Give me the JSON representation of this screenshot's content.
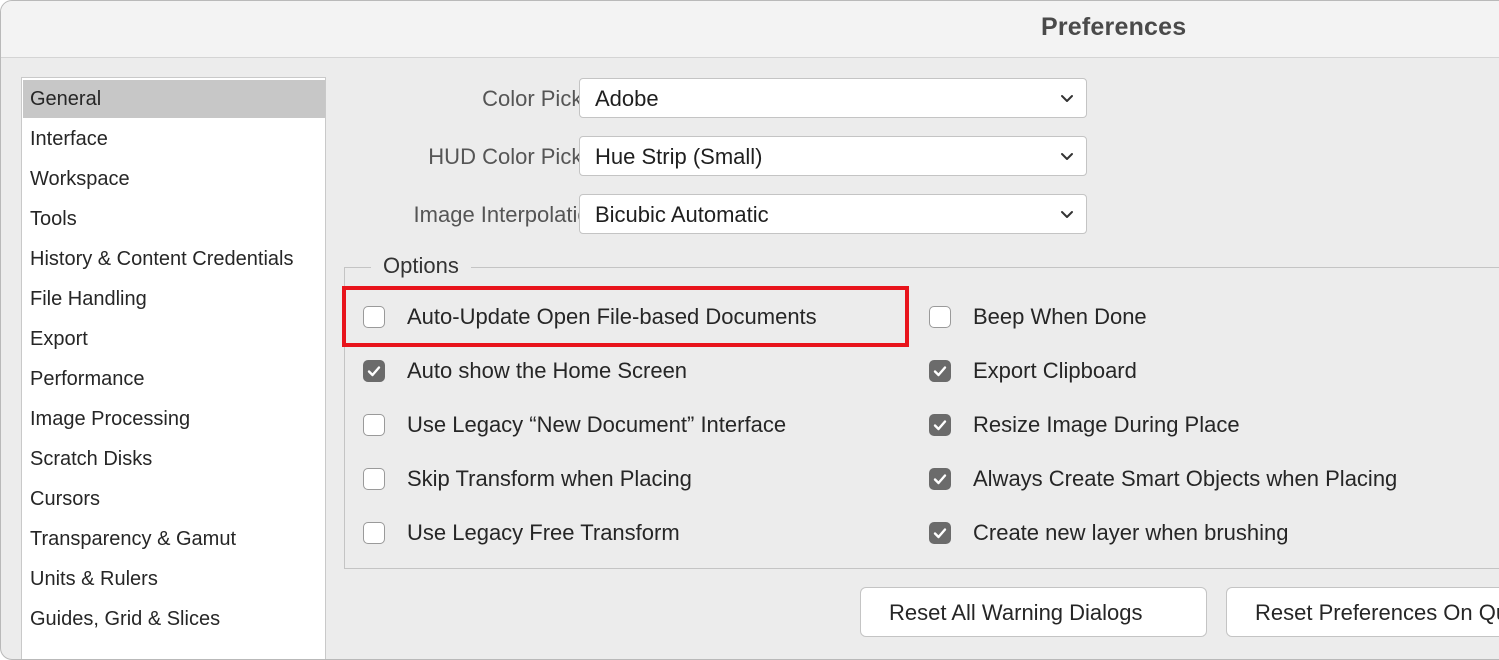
{
  "window": {
    "title": "Preferences"
  },
  "sidebar": {
    "items": [
      {
        "label": "General",
        "selected": true
      },
      {
        "label": "Interface"
      },
      {
        "label": "Workspace"
      },
      {
        "label": "Tools"
      },
      {
        "label": "History & Content Credentials"
      },
      {
        "label": "File Handling"
      },
      {
        "label": "Export"
      },
      {
        "label": "Performance"
      },
      {
        "label": "Image Processing"
      },
      {
        "label": "Scratch Disks"
      },
      {
        "label": "Cursors"
      },
      {
        "label": "Transparency & Gamut"
      },
      {
        "label": "Units & Rulers"
      },
      {
        "label": "Guides, Grid & Slices"
      }
    ]
  },
  "general": {
    "color_picker": {
      "label": "Color Picker:",
      "value": "Adobe"
    },
    "hud_color_picker": {
      "label": "HUD Color Picker:",
      "value": "Hue Strip (Small)"
    },
    "image_interpolation": {
      "label": "Image Interpolation:",
      "value": "Bicubic Automatic"
    },
    "options": {
      "legend": "Options",
      "left": [
        {
          "label": "Auto-Update Open File-based Documents",
          "checked": false,
          "highlighted": true
        },
        {
          "label": "Auto show the Home Screen",
          "checked": true
        },
        {
          "label": "Use Legacy “New Document” Interface",
          "checked": false
        },
        {
          "label": "Skip Transform when Placing",
          "checked": false
        },
        {
          "label": "Use Legacy Free Transform",
          "checked": false
        }
      ],
      "right": [
        {
          "label": "Beep When Done",
          "checked": false
        },
        {
          "label": "Export Clipboard",
          "checked": true
        },
        {
          "label": "Resize Image During Place",
          "checked": true
        },
        {
          "label": "Always Create Smart Objects when Placing",
          "checked": true
        },
        {
          "label": "Create new layer when brushing",
          "checked": true
        }
      ]
    },
    "buttons": {
      "reset_warning": "Reset All Warning Dialogs",
      "reset_preferences": "Reset Preferences On Quit"
    }
  },
  "colors": {
    "highlight_border": "#e8141b",
    "selected_item_bg": "#c7c7c7",
    "checkbox_checked": "#6b6b6b"
  },
  "icons": {
    "dropdown": "chevron-down-icon",
    "checkbox_check": "checkmark-icon"
  }
}
